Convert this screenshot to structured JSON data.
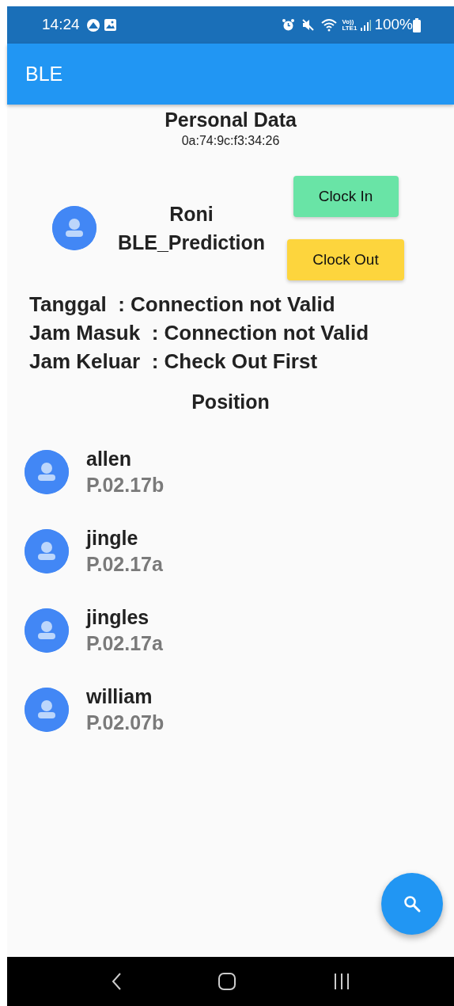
{
  "status_bar": {
    "time": "14:24",
    "network_top": "Vo))",
    "network_bottom": "LTE1",
    "battery": "100%"
  },
  "app_bar": {
    "title": "BLE"
  },
  "header": {
    "title": "Personal Data",
    "device_id": "0a:74:9c:f3:34:26"
  },
  "profile": {
    "name": "Roni",
    "group": "BLE_Prediction"
  },
  "buttons": [
    {
      "label": "Clock In",
      "color": "#69e4a6"
    },
    {
      "label": "Clock Out",
      "color": "#fdd53d"
    }
  ],
  "info_lines": [
    "Tanggal  : Connection not Valid",
    "Jam Masuk  : Connection not Valid",
    "Jam Keluar  : Check Out First"
  ],
  "position_title": "Position",
  "people": [
    {
      "name": "allen",
      "position": "P.02.17b"
    },
    {
      "name": "jingle",
      "position": "P.02.17a"
    },
    {
      "name": "jingles",
      "position": "P.02.17a"
    },
    {
      "name": "william",
      "position": "P.02.07b"
    }
  ]
}
